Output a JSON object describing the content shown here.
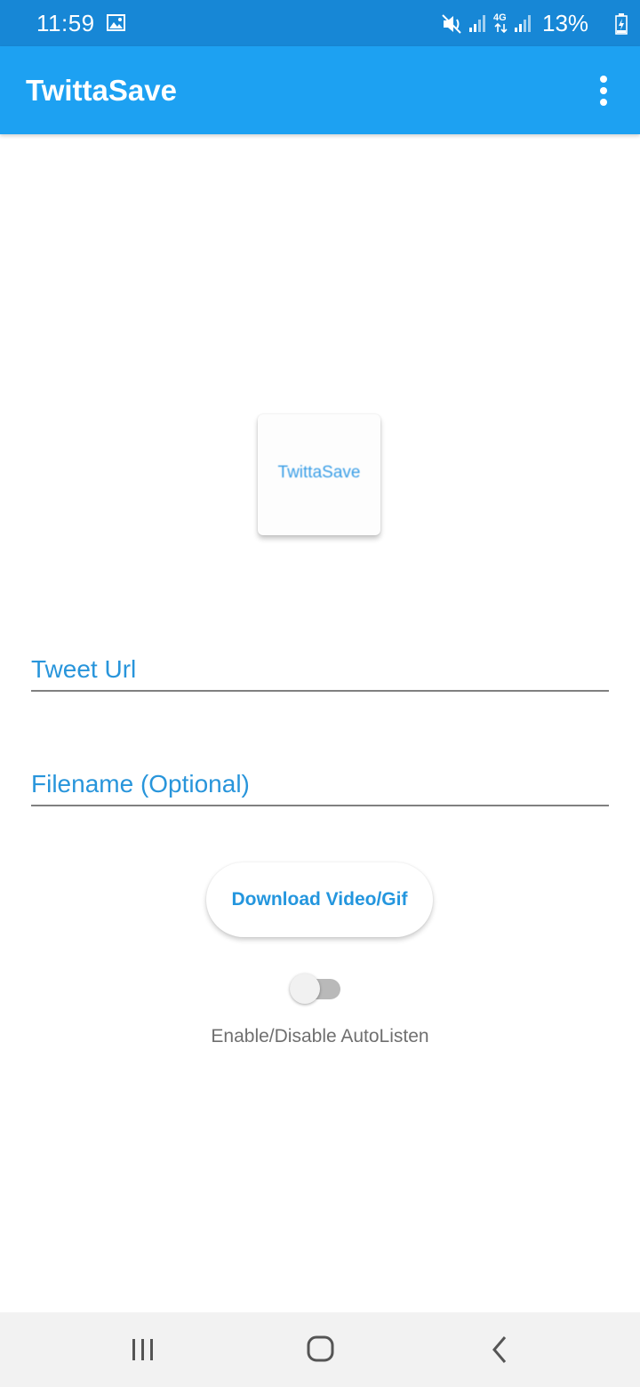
{
  "status_bar": {
    "time": "11:59",
    "battery_percent": "13%",
    "network_type": "4G",
    "icons": [
      "gallery-icon",
      "mute-icon",
      "signal-icon",
      "4g-data-icon",
      "signal-icon",
      "battery-charging-icon"
    ]
  },
  "app_bar": {
    "title": "TwittaSave",
    "menu_icon": "overflow-menu-icon"
  },
  "logo": {
    "text": "TwittaSave"
  },
  "form": {
    "tweet_url_placeholder": "Tweet Url",
    "tweet_url_value": "",
    "filename_placeholder": "Filename (Optional)",
    "filename_value": "",
    "download_label": "Download Video/Gif"
  },
  "autolisten": {
    "label": "Enable/Disable AutoListen",
    "enabled": false
  },
  "nav_bar": {
    "icons": [
      "recents-icon",
      "home-icon",
      "back-icon"
    ]
  },
  "colors": {
    "status_bar": "#1787d6",
    "app_bar": "#1da1f2",
    "accent_text": "#2895db",
    "background": "#ffffff"
  }
}
